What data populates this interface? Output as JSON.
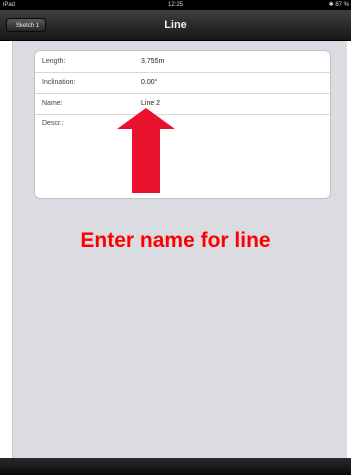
{
  "status_bar": {
    "device": "iPad",
    "time": "12:25",
    "battery": "✱ 87 %"
  },
  "nav": {
    "back_label": "Sketch 1",
    "title": "Line"
  },
  "form": {
    "rows": [
      {
        "label": "Length:",
        "value": "3.755m"
      },
      {
        "label": "Inclination:",
        "value": "0.00°"
      },
      {
        "label": "Name:",
        "value": "Line 2"
      },
      {
        "label": "Descr.:",
        "value": ""
      }
    ]
  },
  "annotation": {
    "text": "Enter name for line",
    "color": "#ff0000",
    "arrow_color": "#e8122d"
  }
}
